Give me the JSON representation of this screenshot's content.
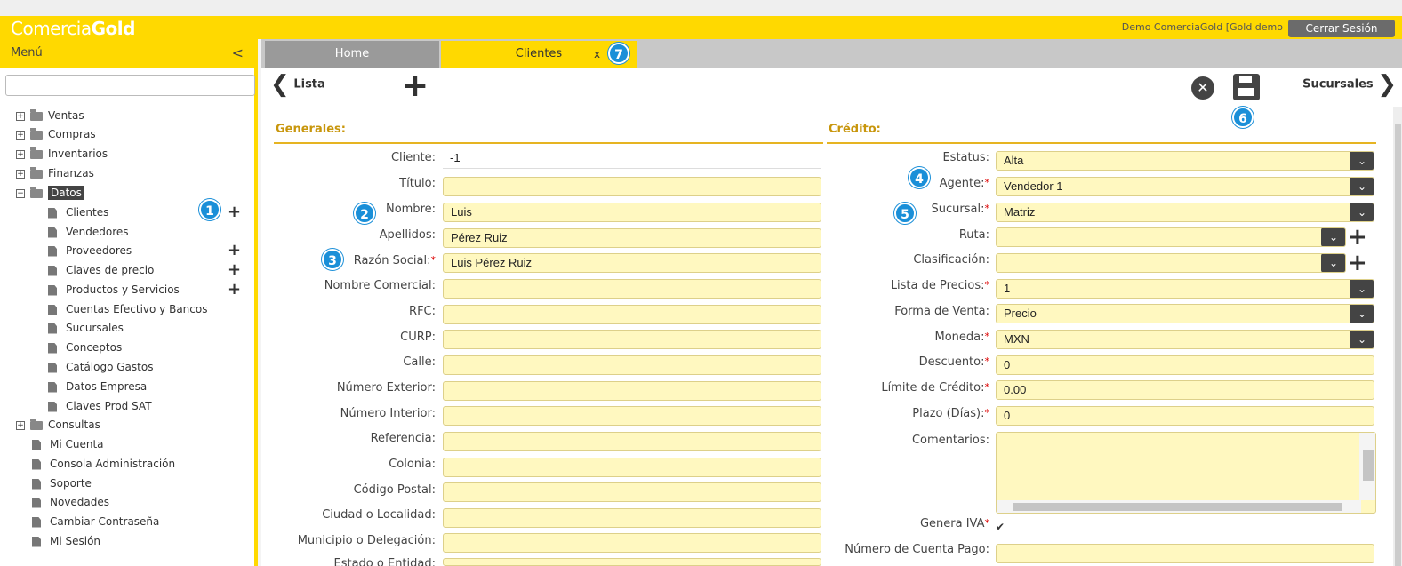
{
  "header": {
    "logo_part1": "Comercia",
    "logo_part2": "Gold",
    "user_label": "Demo ComerciaGold [Gold demo",
    "logout_label": "Cerrar Sesión"
  },
  "sidebar": {
    "title": "Menú",
    "collapse_glyph": "<",
    "search_value": "",
    "items": [
      {
        "label": "Ventas"
      },
      {
        "label": "Compras"
      },
      {
        "label": "Inventarios"
      },
      {
        "label": "Finanzas"
      },
      {
        "label": "Datos"
      },
      {
        "label": "Clientes"
      },
      {
        "label": "Vendedores"
      },
      {
        "label": "Proveedores"
      },
      {
        "label": "Claves de precio"
      },
      {
        "label": "Productos y Servicios"
      },
      {
        "label": "Cuentas Efectivo y Bancos"
      },
      {
        "label": "Sucursales"
      },
      {
        "label": "Conceptos"
      },
      {
        "label": "Catálogo Gastos"
      },
      {
        "label": "Datos Empresa"
      },
      {
        "label": "Claves Prod SAT"
      },
      {
        "label": "Consultas"
      },
      {
        "label": "Mi Cuenta"
      },
      {
        "label": "Consola Administración"
      },
      {
        "label": "Soporte"
      },
      {
        "label": "Novedades"
      },
      {
        "label": "Cambiar Contraseña"
      },
      {
        "label": "Mi Sesión"
      }
    ]
  },
  "tabs": {
    "home": "Home",
    "clientes": "Clientes",
    "close": "x"
  },
  "toolbar": {
    "back_label": "Lista",
    "next_label": "Sucursales"
  },
  "badges": [
    "1",
    "2",
    "3",
    "4",
    "5",
    "6",
    "7"
  ],
  "generales": {
    "title": "Generales:",
    "fields": [
      {
        "label": "Cliente:",
        "value": "-1",
        "required": false
      },
      {
        "label": "Título:",
        "value": "",
        "required": false
      },
      {
        "label": "Nombre:",
        "value": "Luis",
        "required": false
      },
      {
        "label": "Apellidos:",
        "value": "Pérez Ruiz",
        "required": false
      },
      {
        "label": "Razón Social:",
        "value": "Luis Pérez Ruiz",
        "required": true
      },
      {
        "label": "Nombre Comercial:",
        "value": "",
        "required": false
      },
      {
        "label": "RFC:",
        "value": "",
        "required": false
      },
      {
        "label": "CURP:",
        "value": "",
        "required": false
      },
      {
        "label": "Calle:",
        "value": "",
        "required": false
      },
      {
        "label": "Número Exterior:",
        "value": "",
        "required": false
      },
      {
        "label": "Número Interior:",
        "value": "",
        "required": false
      },
      {
        "label": "Referencia:",
        "value": "",
        "required": false
      },
      {
        "label": "Colonia:",
        "value": "",
        "required": false
      },
      {
        "label": "Código Postal:",
        "value": "",
        "required": false
      },
      {
        "label": "Ciudad o Localidad:",
        "value": "",
        "required": false
      },
      {
        "label": "Municipio o Delegación:",
        "value": "",
        "required": false
      },
      {
        "label": "Estado o Entidad:",
        "value": "",
        "required": false
      }
    ]
  },
  "credito": {
    "title": "Crédito:",
    "fields": [
      {
        "label": "Estatus:",
        "value": "Alta",
        "required": false
      },
      {
        "label": "Agente:",
        "value": "Vendedor 1",
        "required": true
      },
      {
        "label": "Sucursal:",
        "value": "Matriz",
        "required": true
      },
      {
        "label": "Ruta:",
        "value": "",
        "required": false
      },
      {
        "label": "Clasificación:",
        "value": "",
        "required": false
      },
      {
        "label": "Lista de Precios:",
        "value": "1",
        "required": true
      },
      {
        "label": "Forma de Venta:",
        "value": "Precio",
        "required": false
      },
      {
        "label": "Moneda:",
        "value": "MXN",
        "required": true
      },
      {
        "label": "Descuento:",
        "value": "0",
        "required": true
      },
      {
        "label": "Límite de Crédito:",
        "value": "0.00",
        "required": true
      },
      {
        "label": "Plazo (Días):",
        "value": "0",
        "required": true
      },
      {
        "label": "Comentarios:",
        "value": "",
        "required": false
      },
      {
        "label": "Genera IVA",
        "value": "checked",
        "required": true
      },
      {
        "label": "Número de Cuenta Pago:",
        "value": "",
        "required": false
      }
    ]
  },
  "required_mark": "*",
  "check_glyph": "✔",
  "colors": {
    "brand_yellow": "#ffd900",
    "field_bg": "#fff8c0",
    "section_title": "#c8960c",
    "badge_blue": "#1a8fd8"
  }
}
